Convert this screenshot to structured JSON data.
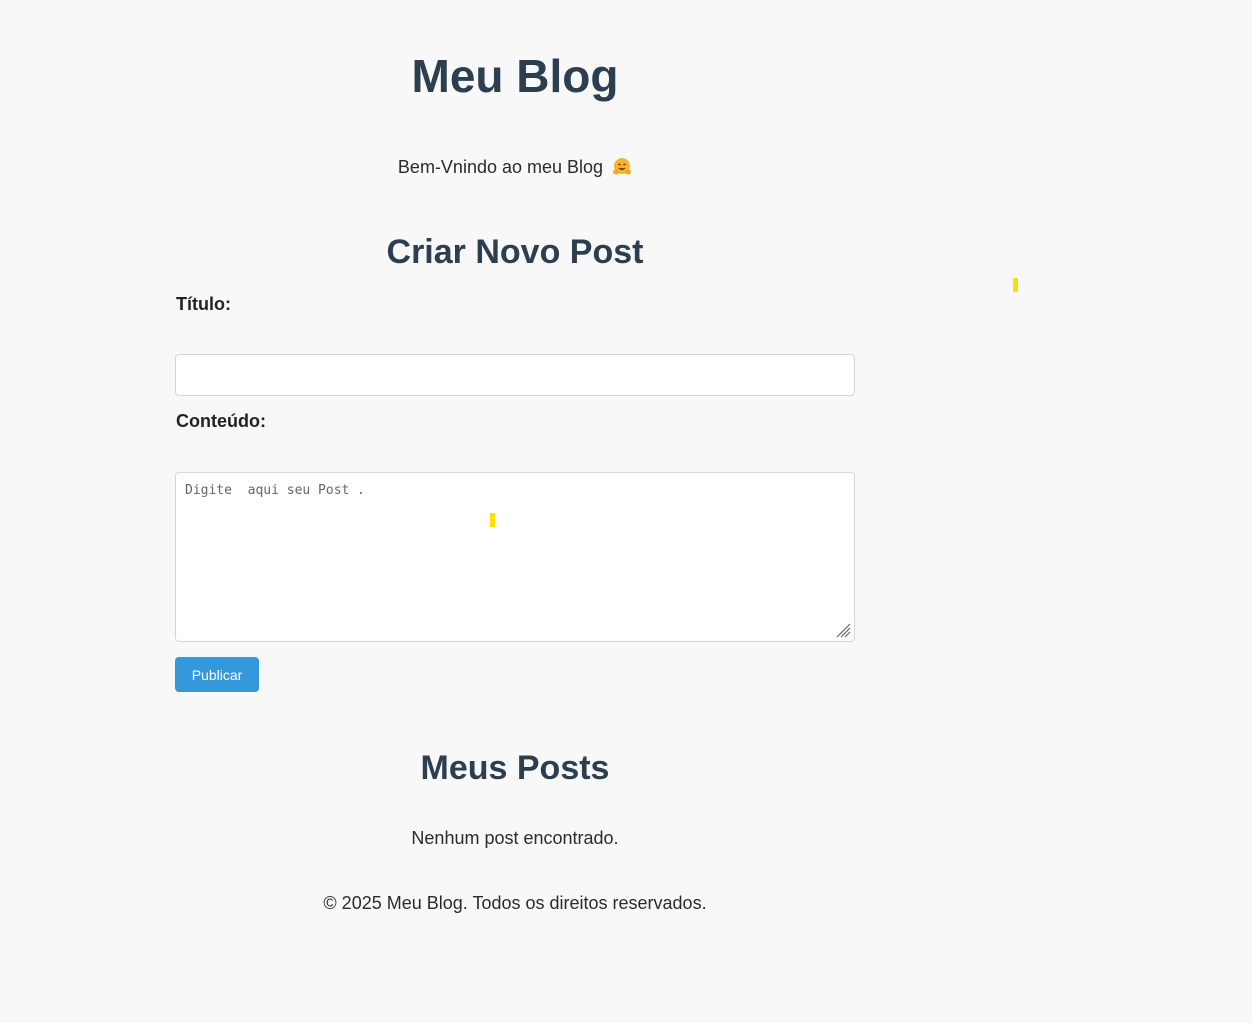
{
  "header": {
    "title": "Meu Blog",
    "welcome": "Bem-Vnindo ao meu Blog"
  },
  "create_post": {
    "heading": "Criar Novo Post",
    "title_label": "Título:",
    "title_value": "",
    "content_label": "Conteúdo:",
    "content_placeholder": "Digite  aqui seu Post .",
    "publish_label": "Publicar"
  },
  "posts": {
    "heading": "Meus Posts",
    "empty_message": "Nenhum post encontrado."
  },
  "footer": {
    "text": "© 2025 Meu Blog. Todos os direitos reservados."
  },
  "colors": {
    "accent": "#3498db",
    "heading": "#2c3e50",
    "background": "#f8f8f8",
    "cursor_highlight": "#ffe000"
  },
  "icons": {
    "welcome_emoji": "hugging-face-icon"
  }
}
